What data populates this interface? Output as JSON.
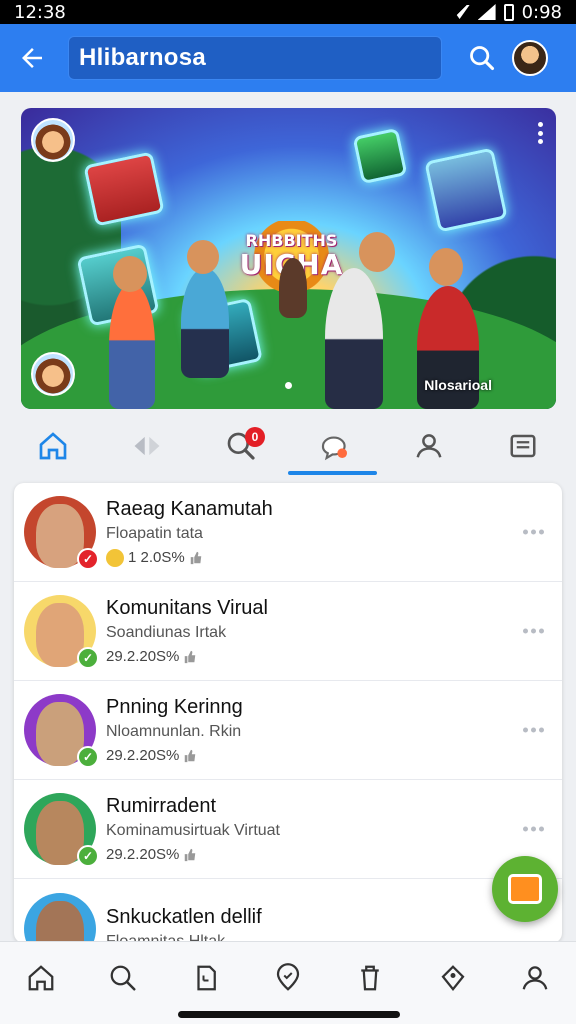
{
  "status_bar": {
    "time": "12:38",
    "battery": "0:98"
  },
  "app_bar": {
    "search_value": "Hlibarnosa"
  },
  "hero": {
    "logo_top": "RHBBITHS",
    "logo_bottom": "UICHA",
    "caption": "Nlosarioal"
  },
  "tabs": [
    {
      "icon": "home-icon",
      "active": false
    },
    {
      "icon": "diamond-arrows-icon",
      "active": false
    },
    {
      "icon": "search-icon",
      "active": false,
      "badge": "0"
    },
    {
      "icon": "chat-bubble-icon",
      "active": true
    },
    {
      "icon": "person-icon",
      "active": false
    },
    {
      "icon": "document-icon",
      "active": false
    }
  ],
  "feed": {
    "items": [
      {
        "title": "Raeag Kanamutah",
        "subtitle": "Floapatin tata",
        "meta": "1 2.0S%",
        "verify_color": "#e3242b",
        "avatar_bg": "#c4462d",
        "face": "#d7a27e"
      },
      {
        "title": "Komunitans Virual",
        "subtitle": "Soandiunas Irtak",
        "meta": "29.2.20S%",
        "verify_color": "#4caf3c",
        "avatar_bg": "#f7d86a",
        "face": "#e0a577"
      },
      {
        "title": "Pnning Kerinng",
        "subtitle": "Nloamnunlan. Rkin",
        "meta": "29.2.20S%",
        "verify_color": "#4caf3c",
        "avatar_bg": "#8d3ac8",
        "face": "#caa07b"
      },
      {
        "title": "Rumirradent",
        "subtitle": "Kominamusirtuak Virtuat",
        "meta": "29.2.20S%",
        "verify_color": "#4caf3c",
        "avatar_bg": "#2ea65a",
        "face": "#b7875e"
      },
      {
        "title": "Snkuckatlen dellif",
        "subtitle": "Floamnitas Hltak",
        "meta": "",
        "verify_color": "",
        "avatar_bg": "#3ba5e2",
        "face": "#a37557"
      }
    ]
  },
  "colors": {
    "app_bar": "#2d7ef0",
    "accent": "#1e86e8",
    "fab": "#5db232"
  },
  "bottom_nav": [
    "home-icon",
    "search-icon",
    "document-icon",
    "location-icon",
    "trash-icon",
    "tag-icon",
    "person-icon"
  ]
}
